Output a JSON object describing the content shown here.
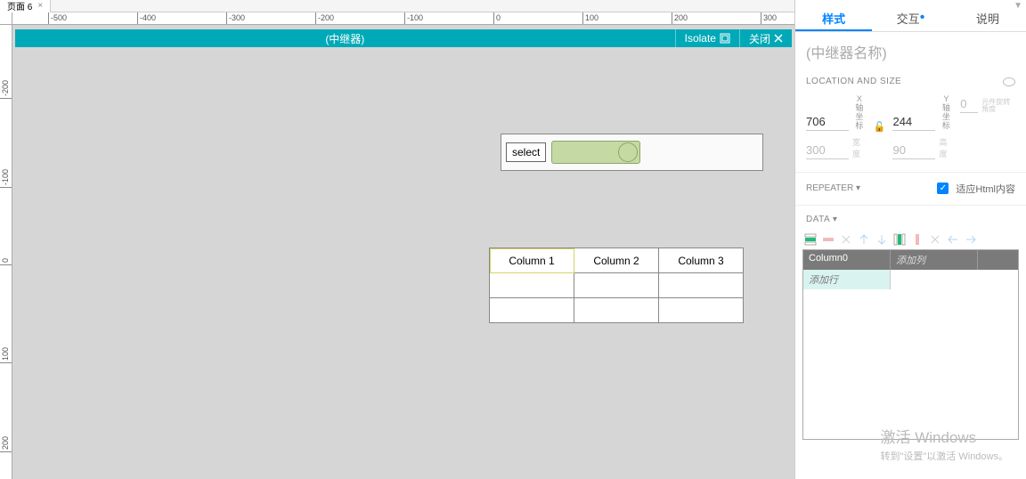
{
  "tab": {
    "label": "页面 6",
    "close": "×"
  },
  "ruler_h": [
    -500,
    -400,
    -300,
    -200,
    -100,
    0,
    100,
    200,
    300
  ],
  "ruler_v": [
    -200,
    -100,
    0,
    100,
    200
  ],
  "editbar": {
    "title": "(中继器)",
    "isolate": "Isolate",
    "close": "关闭"
  },
  "droplist": {
    "label": "select"
  },
  "table": {
    "cols": [
      "Column 1",
      "Column 2",
      "Column 3"
    ]
  },
  "inspector": {
    "tabs": {
      "style": "样式",
      "interact": "交互",
      "notes": "说明"
    },
    "name_placeholder": "(中继器名称)",
    "loc_head": "LOCATION AND SIZE",
    "x_label": "X",
    "y_label": "Y",
    "x_unit": "轴坐标",
    "y_unit": "轴坐标",
    "x": "706",
    "y": "244",
    "w": "300",
    "h": "90",
    "w_unit": "宽度",
    "h_unit": "高度",
    "rot": "0",
    "rot_unit": "元件旋转角度",
    "repeater_head": "REPEATER ▾",
    "fit_html": "适应Html内容",
    "data_head": "DATA ▾",
    "col0": "Column0",
    "add_col": "添加列",
    "add_row": "添加行"
  },
  "watermark": {
    "l1": "激活 Windows",
    "l2": "转到\"设置\"以激活 Windows。"
  }
}
